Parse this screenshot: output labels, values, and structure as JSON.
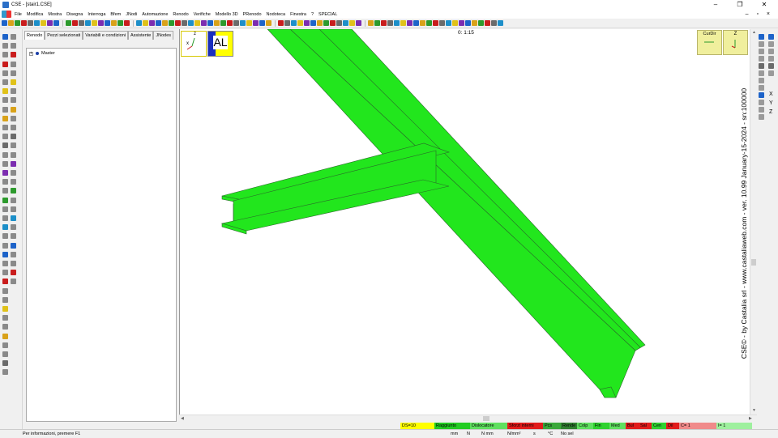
{
  "window": {
    "title": "CSE - [stair1.CSE]",
    "controls": {
      "minimize": "–",
      "maximize": "❐",
      "close": "✕"
    }
  },
  "menu": {
    "items": [
      "File",
      "Modifica",
      "Mostra",
      "Disegna",
      "Interroga",
      "Bfem",
      "JNodi",
      "Automazione",
      "Renodo",
      "Verifiche",
      "Modello 3D",
      "PRenodo",
      "Nodoteca",
      "Finestra",
      "?",
      "SPECIAL"
    ],
    "mdi_controls": "– ▫ ×"
  },
  "panel": {
    "tabs": [
      "Renodo",
      "Pezzi selezionati",
      "Variabili e condizioni",
      "Assistente",
      "JNodes"
    ],
    "active_tab": 0,
    "tree": {
      "expander": "+",
      "root_label": "Master"
    }
  },
  "viewport": {
    "zoom_label": "0: 1:15",
    "axis_box": {
      "z": "z",
      "x": "x"
    },
    "al_label": "AL",
    "curdir_label": "CurDir",
    "zbox_label": "Z",
    "version_text": "CSE© - by Castalia srl - www.castaliaweb.com - ver. 10.99 January-15-2024 - sn:100000",
    "beam_color": "#22e61d"
  },
  "right_strip": {
    "letters": [
      "X",
      "Y",
      "Z"
    ]
  },
  "status": {
    "message": "Per informazioni, premere F1",
    "cells": [
      {
        "text": "DS=10",
        "bg": "#ffff00"
      },
      {
        "text": "Bulloni",
        "bg": "#ffff00"
      },
      {
        "text": "Raggiunto",
        "bg": "#22cc22"
      },
      {
        "text": "Dislocatore",
        "bg": "#5fe05f"
      },
      {
        "text": "Sforzi interni",
        "bg": "#e21b1b"
      },
      {
        "text": "Pcs",
        "bg": "#3aa83a"
      },
      {
        "text": "Rende",
        "bg": "#2f7f2f"
      },
      {
        "text": "Colp",
        "bg": "#5fe05f"
      },
      {
        "text": "Fin",
        "bg": "#2fd22f"
      },
      {
        "text": "Med",
        "bg": "#5fe05f"
      },
      {
        "text": "Bul",
        "bg": "#e21b1b"
      },
      {
        "text": "Sal",
        "bg": "#e21b1b"
      },
      {
        "text": "Cen",
        "bg": "#2fd22f"
      },
      {
        "text": "Dil",
        "bg": "#e21b1b"
      },
      {
        "text": "C= 1",
        "bg": "#f08a8a"
      },
      {
        "text": "I= 1",
        "bg": "#9ef09e"
      }
    ],
    "units": [
      "mm",
      "N",
      "N mm",
      "N/mm²",
      "s",
      "°C",
      "No sel"
    ]
  },
  "colors": {
    "toolbar_icons": [
      "#1d63c9",
      "#d9a21a",
      "#2d9a2d",
      "#c91d1d",
      "#6b6b6b",
      "#1d8fc9",
      "#e0c21a",
      "#7c2db0"
    ]
  }
}
